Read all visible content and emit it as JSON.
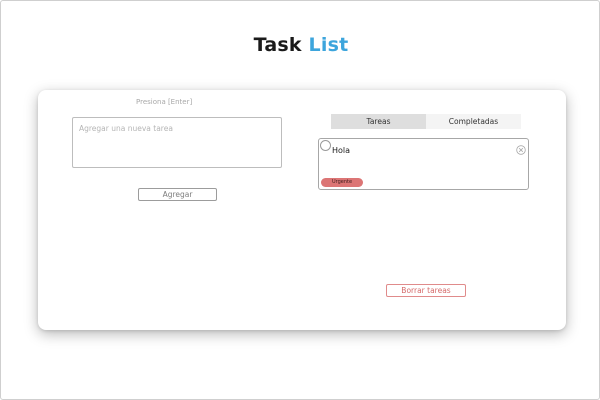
{
  "header": {
    "title_part1": "Task",
    "title_part2": "List"
  },
  "composer": {
    "hint": "Presiona [Enter]",
    "placeholder": "Agregar una nueva tarea",
    "value": "",
    "add_label": "Agregar"
  },
  "tabs": [
    {
      "label": "Tareas",
      "active": true
    },
    {
      "label": "Completadas",
      "active": false
    }
  ],
  "tasks": [
    {
      "text": "Hola",
      "badge": "Urgente",
      "completed": false
    }
  ],
  "footer": {
    "clear_label": "Borrar tareas"
  },
  "colors": {
    "accent": "#3da5dc",
    "urgent": "#dc7575",
    "danger": "#d46a6a"
  },
  "icons": {
    "complete": "circle-outline-icon",
    "delete": "close-circle-icon"
  }
}
